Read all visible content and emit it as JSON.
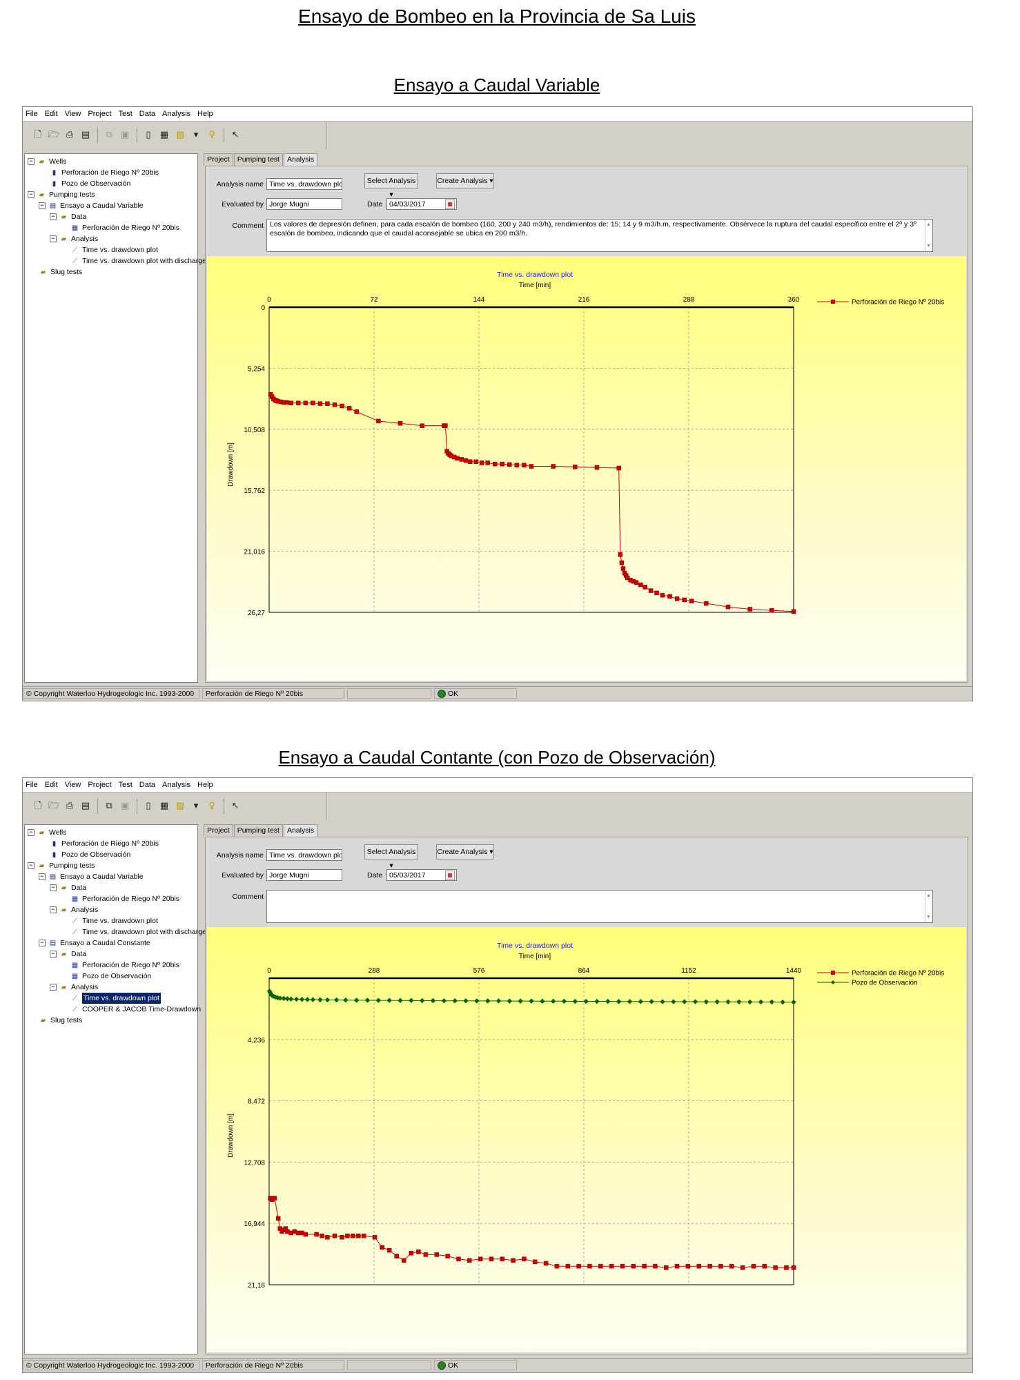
{
  "page_title": "Ensayo de Bombeo en la Provincia de Sa Luis",
  "menu": [
    "File",
    "Edit",
    "View",
    "Project",
    "Test",
    "Data",
    "Analysis",
    "Help"
  ],
  "tabs": [
    "Project",
    "Pumping test",
    "Analysis"
  ],
  "status_copyright": "© Copyright Waterloo Hydrogeologic Inc. 1993-2000",
  "status_well": "Perforación de Riego Nº 20bis",
  "status_ok": "OK",
  "labels": {
    "analysis_name": "Analysis name",
    "evaluated_by": "Evaluated by",
    "date": "Date",
    "comment": "Comment",
    "select_analysis": "Select Analysis",
    "create_analysis": "Create Analysis"
  },
  "section1": {
    "subtitle": "Ensayo a Caudal Variable",
    "tree": {
      "wells": "Wells",
      "well1": "Perforación de Riego Nº 20bis",
      "well2": "Pozo de Observación",
      "pumping_tests": "Pumping tests",
      "test1": "Ensayo a Caudal Variable",
      "data": "Data",
      "data_well": "Perforación de Riego Nº 20bis",
      "analysis": "Analysis",
      "an1": "Time vs. drawdown plot",
      "an2": "Time vs. drawdown plot with discharge",
      "slug": "Slug tests"
    },
    "form": {
      "analysis_name": "Time vs. drawdown plot",
      "evaluated_by": "Jorge Mugni",
      "date": "04/03/2017",
      "comment": "Los valores de depresión definen, para cada escalón de bombeo (160, 200 y 240 m3/h), rendimientos de: 15; 14 y 9 m3/h.m, respectivamente. Obsérvece la ruptura del caudal específico entre el 2º y 3º escalón de bombeo, indicando que el caudal aconsejable se ubica en 200 m3/h."
    }
  },
  "section2": {
    "subtitle": "Ensayo a Caudal Contante (con Pozo de Observación)",
    "tree": {
      "wells": "Wells",
      "well1": "Perforación de Riego Nº 20bis",
      "well2": "Pozo de Observación",
      "pumping_tests": "Pumping tests",
      "test1": "Ensayo a Caudal Variable",
      "data": "Data",
      "data_well": "Perforación de Riego Nº 20bis",
      "analysis": "Analysis",
      "an1": "Time vs. drawdown plot",
      "an2": "Time vs. drawdown plot with discharge",
      "test2": "Ensayo a Caudal Constante",
      "data2": "Data",
      "data2_well1": "Perforación de Riego Nº 20bis",
      "data2_well2": "Pozo de Observación",
      "analysis2": "Analysis",
      "an3": "Time vs. drawdown plot",
      "an4": "COOPER & JACOB Time-Drawdown",
      "slug": "Slug tests"
    },
    "form": {
      "analysis_name": "Time vs. drawdown plot",
      "evaluated_by": "Jorge Mugni",
      "date": "05/03/2017",
      "comment": ""
    }
  },
  "icons": [
    "new-file-icon",
    "open-folder-icon",
    "print-icon",
    "print-preview-icon",
    "copy-icon",
    "paste-icon",
    "report-icon",
    "calculator-icon",
    "export-icon",
    "dropdown-icon",
    "lightbulb-icon",
    "pointer-icon"
  ],
  "colors": {
    "series_red": "#cc0000",
    "series_green": "#006400",
    "title_blue": "#1a1aff",
    "plot_yellow": "#ffff7a"
  },
  "chart_data": [
    {
      "type": "line",
      "title": "Time vs. drawdown plot",
      "xlabel": "Time [min]",
      "ylabel": "Drawdown [m]",
      "x_ticks": [
        "0",
        "72",
        "144",
        "216",
        "288",
        "360"
      ],
      "y_ticks": [
        "0",
        "5,254",
        "10,508",
        "15,762",
        "21,016",
        "26,27"
      ],
      "xlim": [
        0,
        360
      ],
      "ylim": [
        0,
        26.27
      ],
      "y_inverted": true,
      "grid": true,
      "legend_position": "top-right",
      "series": [
        {
          "name": "Perforación de Riego Nº 20bis",
          "color": "#cc0000",
          "marker": "square",
          "x": [
            1,
            2,
            3,
            4,
            5,
            6,
            8,
            10,
            12,
            15,
            20,
            25,
            30,
            35,
            40,
            45,
            50,
            55,
            60,
            75,
            90,
            105,
            120,
            121,
            122,
            123,
            124,
            125,
            127,
            129,
            132,
            135,
            138,
            142,
            146,
            150,
            155,
            160,
            165,
            170,
            175,
            180,
            195,
            210,
            225,
            240,
            241,
            242,
            243,
            244,
            245,
            246,
            248,
            250,
            252,
            255,
            258,
            262,
            266,
            270,
            275,
            280,
            285,
            290,
            300,
            315,
            330,
            345,
            360
          ],
          "y": [
            7.5,
            7.7,
            7.9,
            8.0,
            8.05,
            8.1,
            8.15,
            8.2,
            8.2,
            8.25,
            8.25,
            8.25,
            8.25,
            8.3,
            8.3,
            8.4,
            8.5,
            8.7,
            9.0,
            9.8,
            10.0,
            10.2,
            10.2,
            10.2,
            12.4,
            12.6,
            12.7,
            12.8,
            12.9,
            13.0,
            13.1,
            13.2,
            13.3,
            13.3,
            13.4,
            13.4,
            13.5,
            13.5,
            13.55,
            13.6,
            13.6,
            13.7,
            13.7,
            13.75,
            13.8,
            13.85,
            21.3,
            22.0,
            22.5,
            22.9,
            23.1,
            23.3,
            23.5,
            23.6,
            23.7,
            23.9,
            24.1,
            24.4,
            24.6,
            24.8,
            24.9,
            25.1,
            25.2,
            25.3,
            25.5,
            25.8,
            26.0,
            26.1,
            26.2
          ]
        }
      ]
    },
    {
      "type": "line",
      "title": "Time vs. drawdown plot",
      "xlabel": "Time [min]",
      "ylabel": "Drawdown [m]",
      "x_ticks": [
        "0",
        "288",
        "576",
        "864",
        "1152",
        "1440"
      ],
      "y_ticks": [
        "4,236",
        "8,472",
        "12,708",
        "16,944",
        "21,18"
      ],
      "xlim": [
        0,
        1440
      ],
      "ylim": [
        0,
        21.18
      ],
      "y_inverted": true,
      "grid": true,
      "legend_position": "top-right",
      "series": [
        {
          "name": "Perforación de Riego Nº 20bis",
          "color": "#cc0000",
          "marker": "square",
          "x": [
            3,
            8,
            15,
            25,
            30,
            35,
            40,
            45,
            50,
            60,
            70,
            80,
            90,
            100,
            130,
            145,
            160,
            180,
            200,
            215,
            230,
            245,
            260,
            290,
            310,
            330,
            350,
            370,
            390,
            410,
            430,
            460,
            490,
            520,
            550,
            580,
            610,
            640,
            670,
            700,
            730,
            760,
            790,
            820,
            850,
            880,
            910,
            940,
            970,
            1000,
            1030,
            1060,
            1090,
            1120,
            1150,
            1180,
            1210,
            1240,
            1270,
            1300,
            1330,
            1360,
            1390,
            1420,
            1440
          ],
          "y": [
            15.2,
            15.3,
            15.2,
            16.6,
            17.3,
            17.5,
            17.4,
            17.3,
            17.5,
            17.6,
            17.5,
            17.6,
            17.6,
            17.7,
            17.7,
            17.8,
            17.9,
            17.8,
            17.9,
            17.8,
            17.8,
            17.8,
            17.8,
            17.9,
            18.6,
            18.8,
            19.2,
            19.5,
            19.0,
            18.9,
            19.1,
            19.1,
            19.2,
            19.4,
            19.5,
            19.4,
            19.4,
            19.4,
            19.5,
            19.4,
            19.6,
            19.7,
            19.9,
            19.9,
            19.9,
            19.9,
            19.9,
            19.9,
            19.9,
            19.9,
            19.9,
            19.9,
            20.0,
            19.9,
            19.9,
            19.9,
            19.9,
            19.9,
            19.9,
            20.0,
            19.9,
            19.9,
            20.0,
            20.0,
            20.0
          ]
        },
        {
          "name": "Pozo de Observación",
          "color": "#006400",
          "marker": "diamond",
          "x": [
            1,
            3,
            5,
            8,
            12,
            17,
            23,
            30,
            40,
            50,
            60,
            75,
            90,
            105,
            120,
            140,
            160,
            185,
            210,
            240,
            270,
            300,
            330,
            360,
            390,
            420,
            450,
            480,
            510,
            540,
            570,
            600,
            630,
            660,
            690,
            720,
            750,
            780,
            810,
            840,
            870,
            900,
            930,
            960,
            990,
            1020,
            1050,
            1080,
            1110,
            1140,
            1170,
            1200,
            1230,
            1260,
            1290,
            1320,
            1350,
            1380,
            1410,
            1440
          ],
          "y": [
            0.9,
            1.0,
            1.1,
            1.2,
            1.25,
            1.3,
            1.35,
            1.38,
            1.4,
            1.42,
            1.44,
            1.45,
            1.46,
            1.47,
            1.48,
            1.49,
            1.5,
            1.5,
            1.51,
            1.52,
            1.52,
            1.53,
            1.53,
            1.54,
            1.54,
            1.55,
            1.55,
            1.56,
            1.56,
            1.56,
            1.57,
            1.57,
            1.57,
            1.58,
            1.58,
            1.58,
            1.59,
            1.59,
            1.59,
            1.6,
            1.6,
            1.6,
            1.6,
            1.61,
            1.61,
            1.61,
            1.61,
            1.62,
            1.62,
            1.62,
            1.62,
            1.63,
            1.63,
            1.63,
            1.63,
            1.64,
            1.64,
            1.64,
            1.65,
            1.65
          ]
        }
      ]
    }
  ]
}
